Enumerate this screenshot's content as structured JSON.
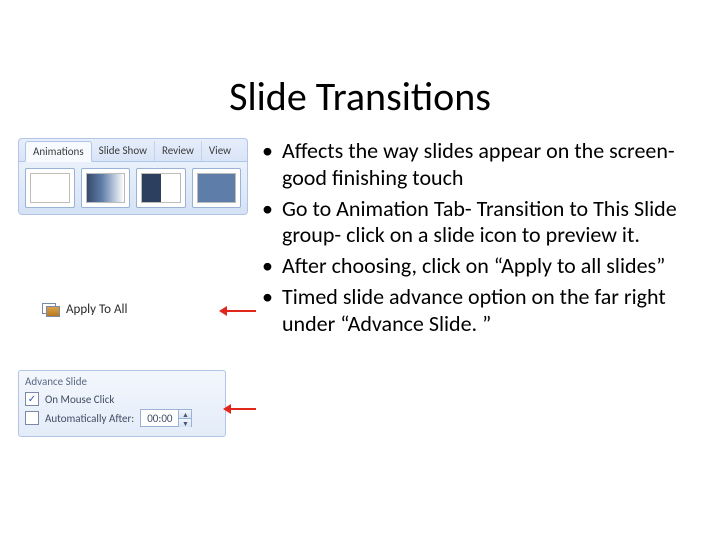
{
  "title": "Slide Transitions",
  "ribbon": {
    "tabs": [
      "Animations",
      "Slide Show",
      "Review",
      "View"
    ]
  },
  "apply_to_all_label": "Apply To All",
  "advance": {
    "group_title": "Advance Slide",
    "on_mouse_click_label": "On Mouse Click",
    "on_mouse_click_checked": true,
    "auto_after_label": "Automatically After:",
    "auto_after_checked": false,
    "auto_after_value": "00:00"
  },
  "bullets": [
    "Affects the way slides appear on the screen- good finishing touch",
    "Go to Animation Tab- Transition to This Slide group- click on a slide icon to preview it.",
    "After choosing, click on “Apply to all slides”",
    "Timed slide advance option on the far right under “Advance Slide. ”"
  ]
}
